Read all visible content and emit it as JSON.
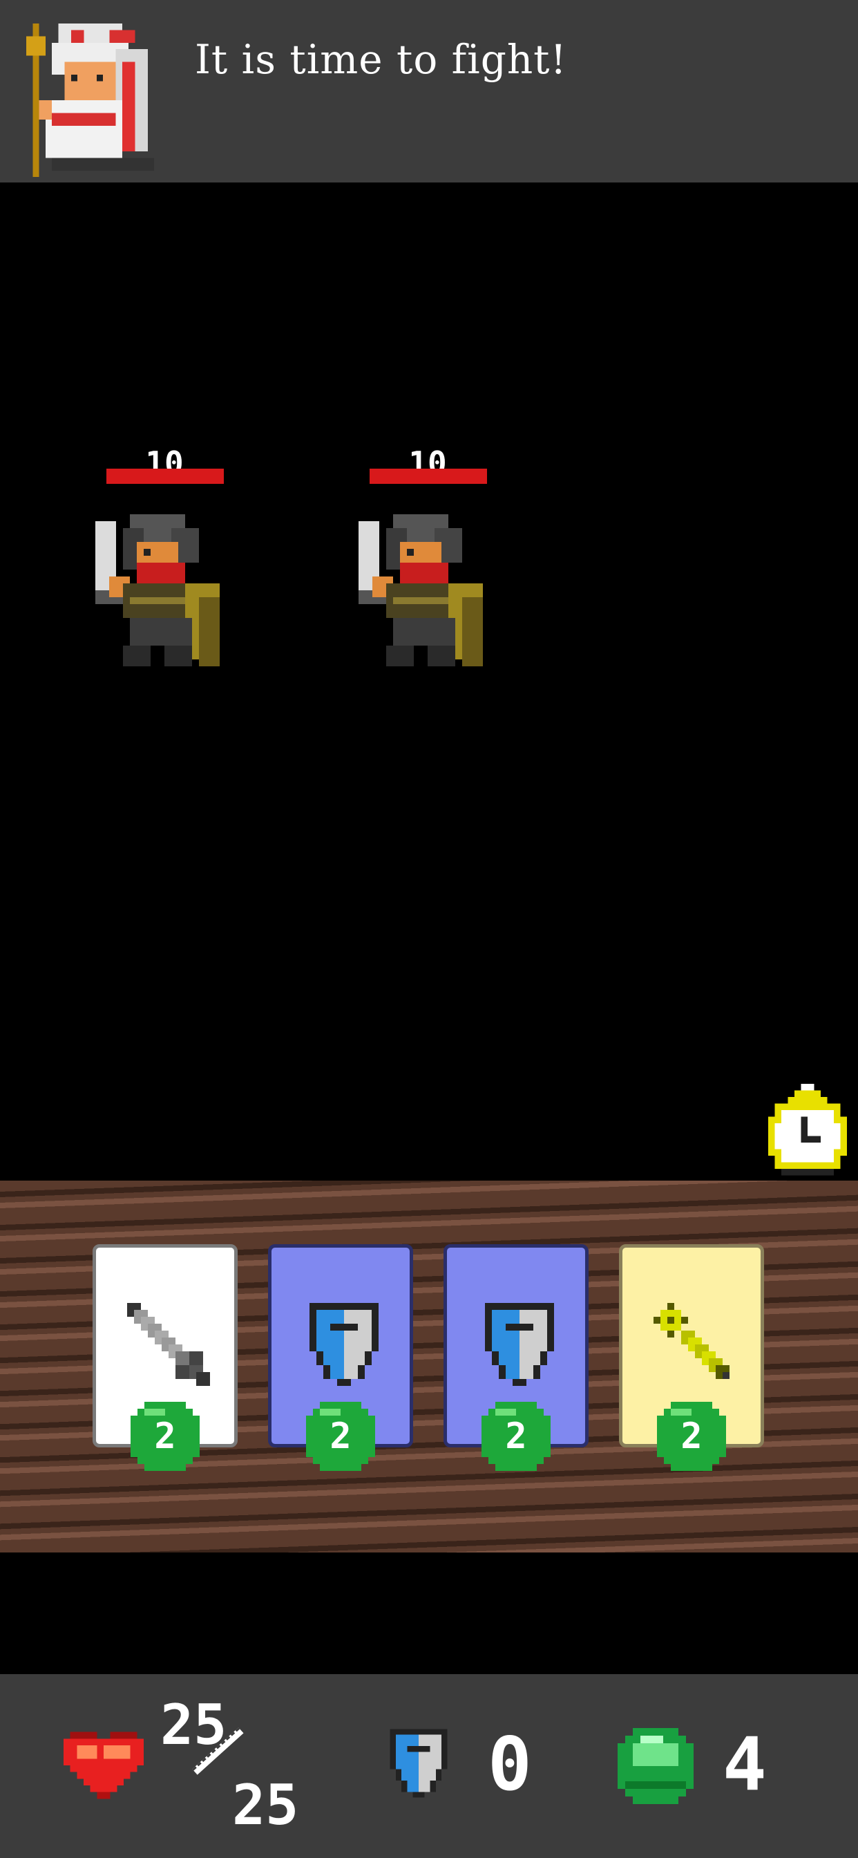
{
  "dialog": {
    "text": "It is time to fight!"
  },
  "enemies": [
    {
      "hp": "10",
      "hp_fraction": 1.0
    },
    {
      "hp": "10",
      "hp_fraction": 1.0
    }
  ],
  "hand": [
    {
      "type": "sword",
      "cost": "2",
      "color": "white"
    },
    {
      "type": "shield",
      "cost": "2",
      "color": "blue"
    },
    {
      "type": "shield",
      "cost": "2",
      "color": "blue"
    },
    {
      "type": "staff",
      "cost": "2",
      "color": "yellow"
    }
  ],
  "stats": {
    "hp_current": "25",
    "hp_max": "25",
    "block": "0",
    "energy": "4"
  },
  "colors": {
    "bar_bg": "#3c3c3c",
    "hp_bar": "#d8191b",
    "card_blue": "#8088f0",
    "card_yellow": "#fdf1a5",
    "cost_green": "#1ea83a"
  },
  "icons": [
    "heart-icon",
    "shield-icon",
    "green-gem-icon",
    "stopwatch-icon",
    "sword-icon",
    "staff-icon"
  ]
}
